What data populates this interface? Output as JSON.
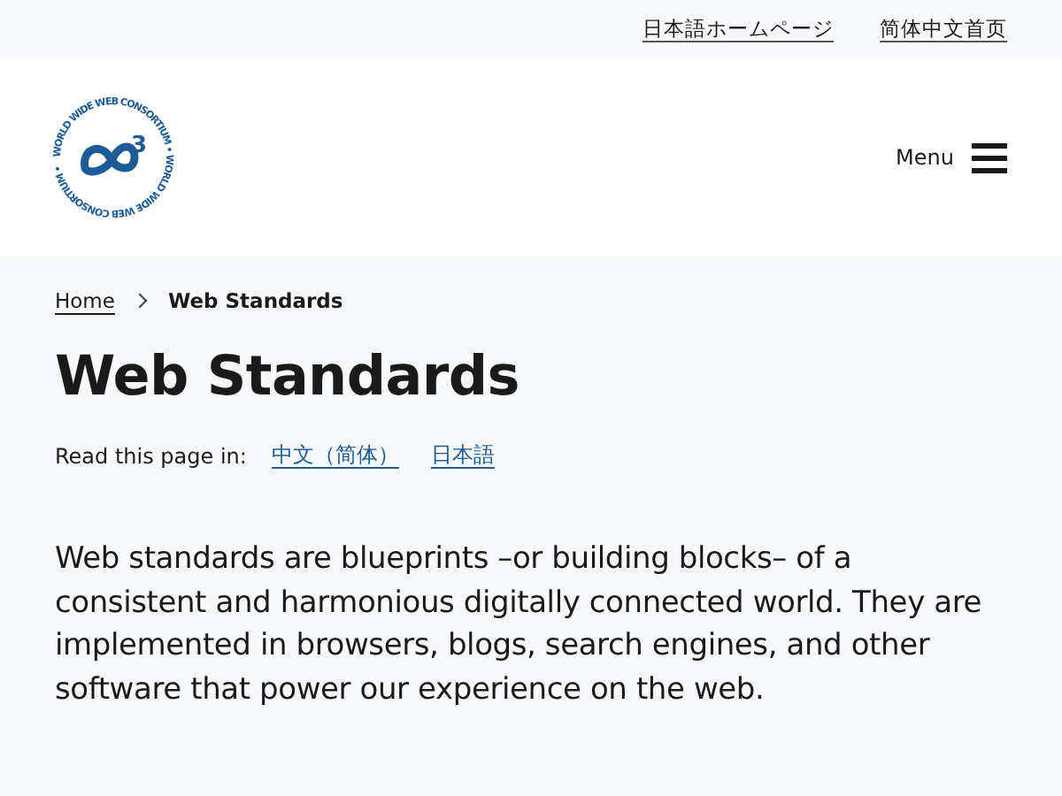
{
  "top_links": [
    "日本語ホームページ",
    "简体中文首页"
  ],
  "logo": {
    "ring_text": "WORLD WIDE WEB CONSORTIUM • WORLD WIDE WEB CONSORTIUM •",
    "superscript": "3"
  },
  "menu": {
    "label": "Menu"
  },
  "breadcrumb": [
    {
      "label": "Home",
      "link": true
    },
    {
      "label": "Web Standards",
      "link": false
    }
  ],
  "title": "Web Standards",
  "languages": {
    "label": "Read this page in:",
    "links": [
      "中文（简体）",
      "日本語"
    ]
  },
  "intro": "Web standards are blueprints –or building blocks– of a consistent and harmonious digitally connected world. They are implemented in browsers, blogs, search engines, and other software that power our experience on the web."
}
